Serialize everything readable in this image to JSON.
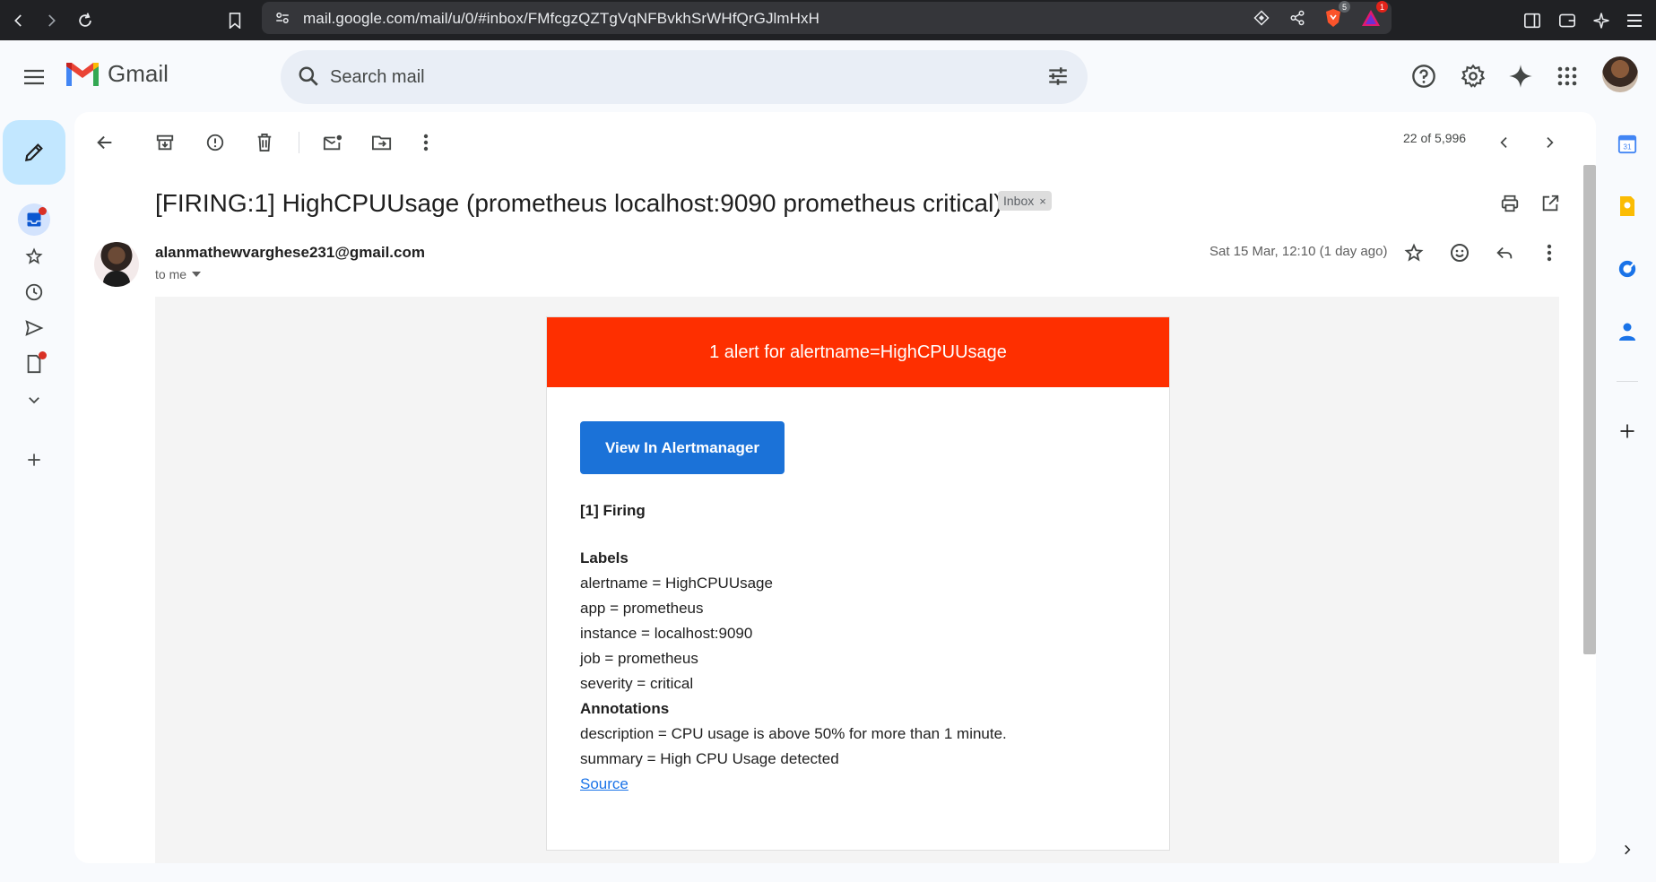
{
  "browser": {
    "url": "mail.google.com/mail/u/0/#inbox/FMfcgzQZTgVqNFBvkhSrWHfQrGJlmHxH",
    "brave_badge": "5",
    "rewards_badge": "1"
  },
  "app": {
    "name": "Gmail",
    "search_placeholder": "Search mail"
  },
  "toolbar": {
    "pager": "22 of 5,996"
  },
  "email": {
    "subject": "[FIRING:1] HighCPUUsage (prometheus localhost:9090 prometheus critical)",
    "label_chip": "Inbox",
    "sender": "alanmathewvarghese231@gmail.com",
    "to": "to me",
    "date": "Sat 15 Mar, 12:10 (1 day ago)"
  },
  "alert_card": {
    "header": "1 alert for alertname=HighCPUUsage",
    "button": "View In Alertmanager",
    "firing": "[1] Firing",
    "labels_heading": "Labels",
    "labels": [
      "alertname = HighCPUUsage",
      "app = prometheus",
      "instance = localhost:9090",
      "job = prometheus",
      "severity = critical"
    ],
    "annotations_heading": "Annotations",
    "annotations": [
      "description = CPU usage is above 50% for more than 1 minute.",
      "summary = High CPU Usage detected"
    ],
    "source_link": "Source"
  },
  "colors": {
    "alert_red": "#fe2f00",
    "button_blue": "#1b72d8",
    "compose_bg": "#c2e7ff"
  }
}
